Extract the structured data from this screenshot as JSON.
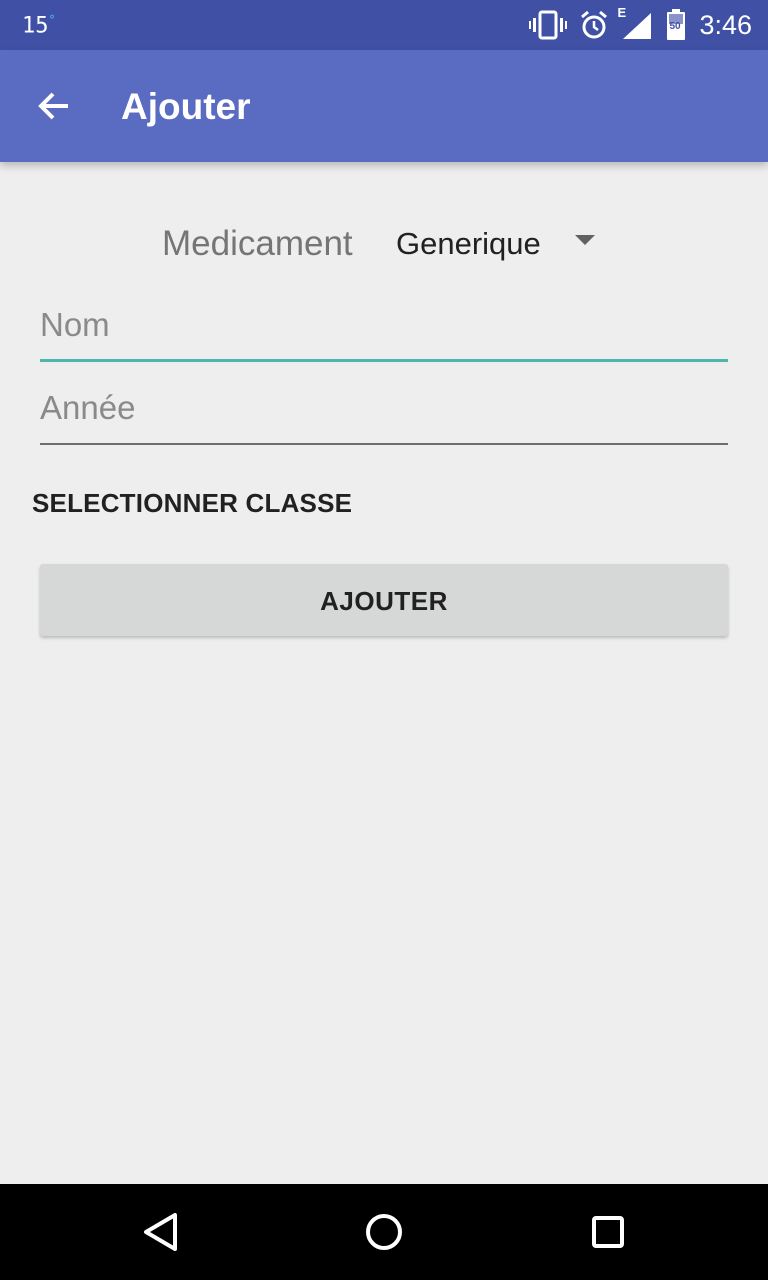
{
  "status_bar": {
    "temperature": "15",
    "temperature_unit": "°",
    "time": "3:46",
    "network_label": "E",
    "battery_level": "50",
    "icons": [
      "vibrate-icon",
      "alarm-icon",
      "signal-icon",
      "battery-icon"
    ]
  },
  "app_bar": {
    "title": "Ajouter",
    "back_icon": "arrow-back-icon"
  },
  "form": {
    "type_label": "Medicament",
    "type_selected": "Generique",
    "nom_placeholder": "Nom",
    "annee_placeholder": "Année",
    "select_class_label": "SELECTIONNER CLASSE",
    "submit_label": "AJOUTER"
  },
  "nav_bar": {
    "icons": [
      "nav-back-icon",
      "nav-home-icon",
      "nav-recents-icon"
    ]
  },
  "colors": {
    "status_bar": "#4051a5",
    "app_bar": "#5a6cc2",
    "accent": "#4db6ac",
    "background": "#eeeeee",
    "button": "#d6d7d7"
  }
}
